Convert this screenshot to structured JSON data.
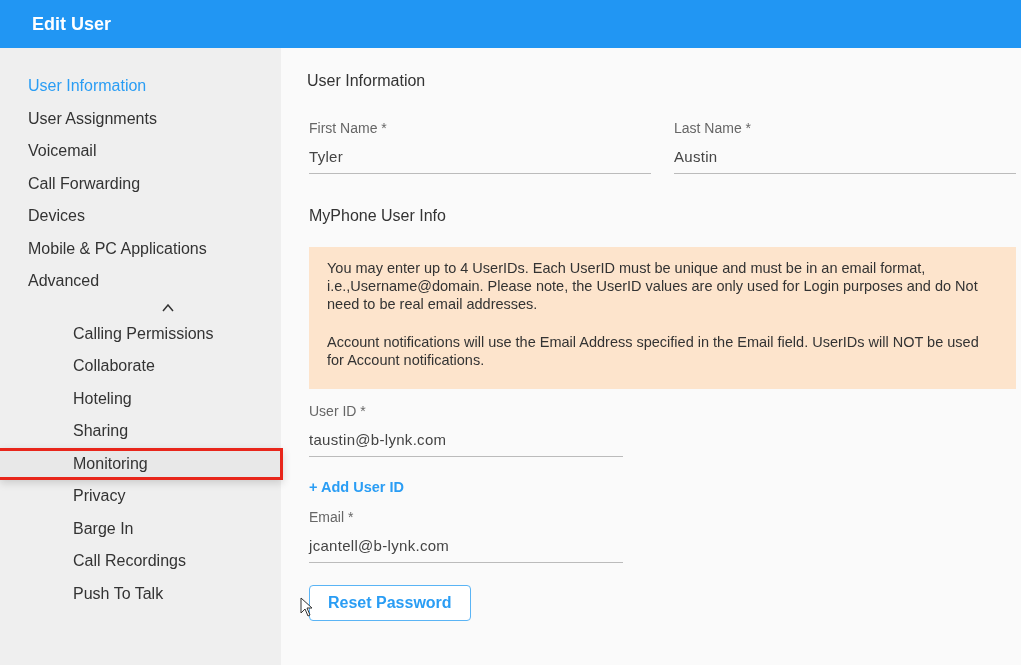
{
  "window": {
    "title": "Edit User"
  },
  "sidebar": {
    "items": [
      {
        "label": "User Information",
        "selected": true
      },
      {
        "label": "User Assignments",
        "selected": false
      },
      {
        "label": "Voicemail",
        "selected": false
      },
      {
        "label": "Call Forwarding",
        "selected": false
      },
      {
        "label": "Devices",
        "selected": false
      },
      {
        "label": "Mobile & PC Applications",
        "selected": false
      },
      {
        "label": "Advanced",
        "selected": false,
        "expanded": true,
        "children": [
          {
            "label": "Calling Permissions",
            "selected": false,
            "highlighted": false
          },
          {
            "label": "Collaborate",
            "selected": false,
            "highlighted": false
          },
          {
            "label": "Hoteling",
            "selected": false,
            "highlighted": false
          },
          {
            "label": "Sharing",
            "selected": false,
            "highlighted": false
          },
          {
            "label": "Monitoring",
            "selected": false,
            "highlighted": true
          },
          {
            "label": "Privacy",
            "selected": false,
            "highlighted": false
          },
          {
            "label": "Barge In",
            "selected": false,
            "highlighted": false
          },
          {
            "label": "Call Recordings",
            "selected": false,
            "highlighted": false
          },
          {
            "label": "Push To Talk",
            "selected": false,
            "highlighted": false
          }
        ]
      }
    ]
  },
  "main": {
    "section_title": "User Information",
    "name_fields": [
      {
        "label": "First Name *",
        "value": "Tyler"
      },
      {
        "label": "Last Name *",
        "value": "Austin"
      }
    ],
    "myphone_title": "MyPhone User Info",
    "notice": [
      "You may enter up to 4 UserIDs. Each UserID must be unique and must be in an email format, i.e.,Username@domain. Please note, the UserID values are only used for Login purposes and do Not need to be real email addresses.",
      "Account notifications will use the Email Address specified in the Email field. UserIDs will NOT be used for Account notifications."
    ],
    "user_id": {
      "label": "User ID *",
      "value": "taustin@b-lynk.com"
    },
    "add_user_id": "+ Add User ID",
    "email": {
      "label": "Email *",
      "value": "jcantell@b-lynk.com"
    },
    "reset_button": "Reset Password"
  }
}
